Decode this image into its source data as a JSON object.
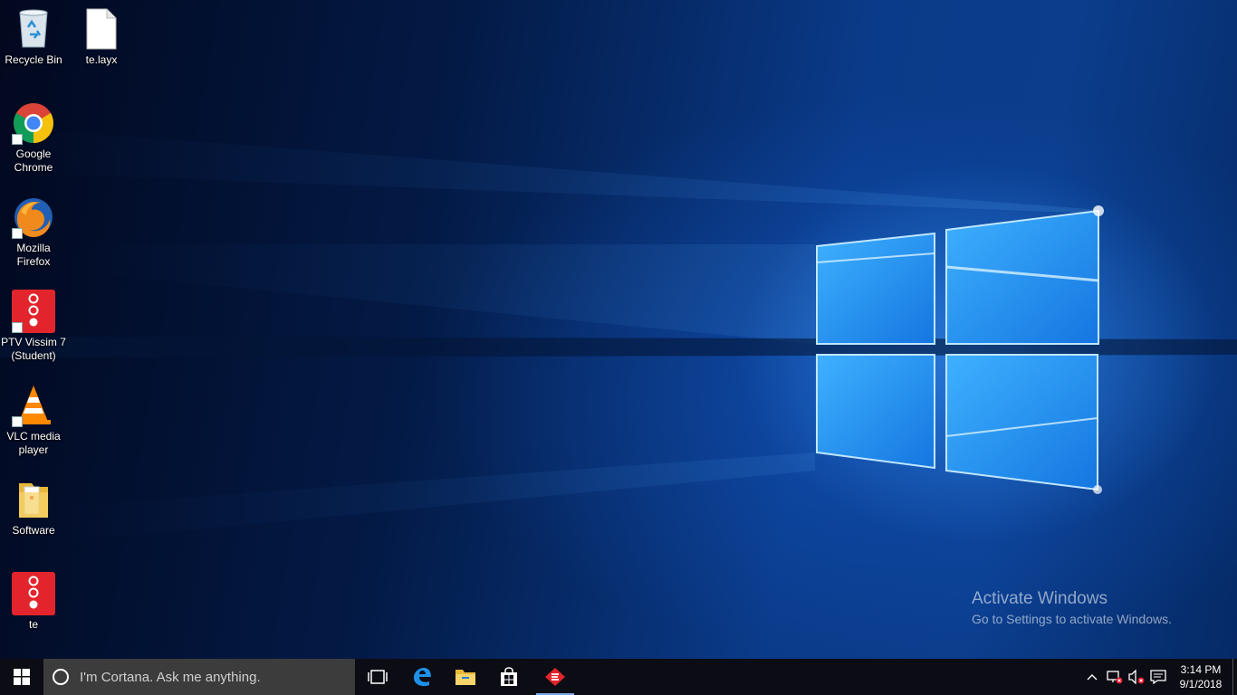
{
  "desktop": {
    "icons": [
      {
        "id": "recycle-bin",
        "label": "Recycle Bin",
        "icon": "recycle-bin-icon"
      },
      {
        "id": "te-layx",
        "label": "te.layx",
        "icon": "file-icon"
      },
      {
        "id": "google-chrome",
        "label": "Google Chrome",
        "icon": "chrome-icon"
      },
      {
        "id": "mozilla-firefox",
        "label": "Mozilla Firefox",
        "icon": "firefox-icon"
      },
      {
        "id": "ptv-vissim",
        "label": "PTV Vissim 7 (Student)",
        "icon": "vissim-icon"
      },
      {
        "id": "vlc",
        "label": "VLC media player",
        "icon": "vlc-cone-icon"
      },
      {
        "id": "software-folder",
        "label": "Software",
        "icon": "folder-icon"
      },
      {
        "id": "te",
        "label": "te",
        "icon": "vissim-icon"
      }
    ],
    "watermark": {
      "title": "Activate Windows",
      "subtitle": "Go to Settings to activate Windows."
    }
  },
  "taskbar": {
    "search_placeholder": "I'm Cortana. Ask me anything.",
    "pinned": [
      "start-icon",
      "task-view-icon",
      "edge-icon",
      "file-explorer-icon",
      "store-icon",
      "vissim-icon"
    ],
    "tray": [
      "chevron-up-icon",
      "network-disconnected-icon",
      "volume-muted-icon",
      "action-center-icon"
    ],
    "clock": {
      "time": "3:14 PM",
      "date": "9/1/2018"
    }
  },
  "colors": {
    "taskbar_bg": "#0c0c14",
    "search_bg": "#3c3c3c",
    "wallpaper_blue": "#0b3d8c",
    "vissim_red": "#e2252c"
  }
}
